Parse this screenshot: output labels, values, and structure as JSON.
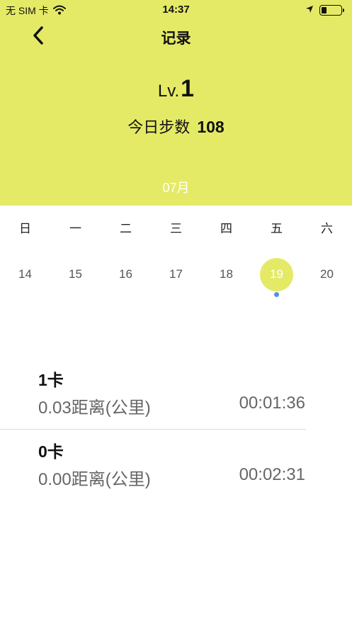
{
  "status_bar": {
    "carrier": "无 SIM 卡",
    "time": "14:37",
    "battery_level": 0.25
  },
  "nav": {
    "title": "记录"
  },
  "summary": {
    "level_prefix": "Lv.",
    "level_value": "1",
    "steps_label": "今日步数",
    "steps_value": "108"
  },
  "calendar": {
    "month": "07月",
    "weekdays": [
      "日",
      "一",
      "二",
      "三",
      "四",
      "五",
      "六"
    ],
    "dates": [
      "14",
      "15",
      "16",
      "17",
      "18",
      "19",
      "20"
    ],
    "selected_date": "19",
    "accent_color": "#e5ea66",
    "dot_color": "#5a8fe0"
  },
  "records": [
    {
      "calories": "1卡",
      "distance": "0.03距离(公里)",
      "duration": "00:01:36"
    },
    {
      "calories": "0卡",
      "distance": "0.00距离(公里)",
      "duration": "00:02:31"
    }
  ]
}
